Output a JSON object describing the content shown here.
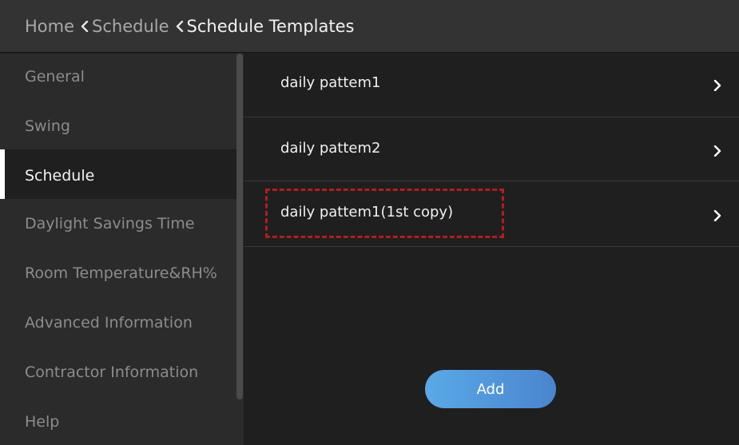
{
  "header": {
    "breadcrumb": [
      {
        "label": "Home"
      },
      {
        "label": "Schedule"
      },
      {
        "label": "Schedule Templates"
      }
    ]
  },
  "sidebar": {
    "items": [
      {
        "label": "General",
        "active": false
      },
      {
        "label": "Swing",
        "active": false
      },
      {
        "label": "Schedule",
        "active": true
      },
      {
        "label": "Daylight Savings Time",
        "active": false
      },
      {
        "label": "Room Temperature&RH%",
        "active": false
      },
      {
        "label": "Advanced Information",
        "active": false
      },
      {
        "label": "Contractor Information",
        "active": false
      },
      {
        "label": "Help",
        "active": false
      }
    ]
  },
  "main": {
    "templates": [
      {
        "label": "daily pattem1",
        "icon": "chevron-right-icon"
      },
      {
        "label": "daily pattem2",
        "icon": "chevron-right-icon"
      },
      {
        "label": "daily pattem1(1st copy)",
        "icon": "chevron-right-icon",
        "highlighted": true
      }
    ],
    "add_label": "Add"
  },
  "colors": {
    "header_bg": "#333333",
    "sidebar_bg": "#2b2b2b",
    "main_bg": "#1f1f1f",
    "highlight_border": "#b01e1e",
    "add_button_gradient": [
      "#5aa9e6",
      "#4a85cf"
    ]
  }
}
